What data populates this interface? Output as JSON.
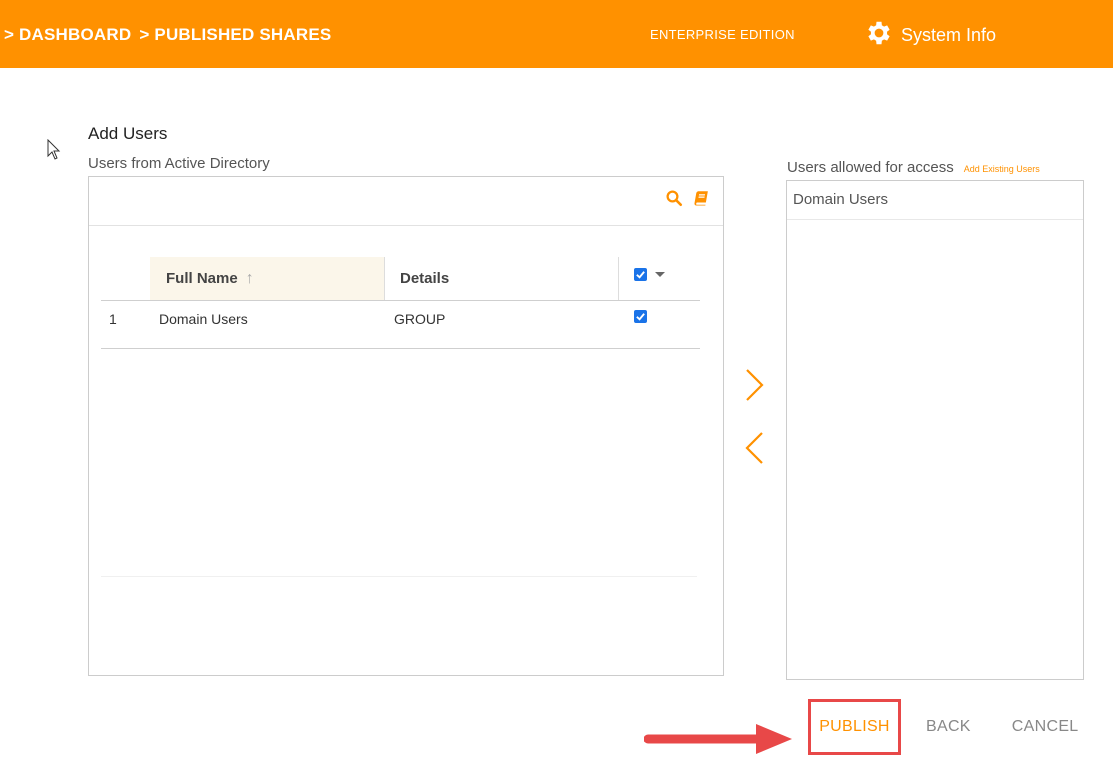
{
  "header": {
    "breadcrumbs": [
      "> DASHBOARD",
      "> PUBLISHED SHARES"
    ],
    "edition": "ENTERPRISE EDITION",
    "system_info": "System Info"
  },
  "page": {
    "title": "Add Users",
    "left_label": "Users from Active Directory",
    "right_label": "Users allowed for access",
    "add_existing": "Add Existing Users"
  },
  "grid": {
    "columns": {
      "num": "",
      "name": "Full Name",
      "details": "Details"
    },
    "header_checked": true,
    "rows": [
      {
        "num": "1",
        "name": "Domain Users",
        "details": "GROUP",
        "checked": true
      }
    ]
  },
  "allowed": {
    "items": [
      "Domain Users"
    ]
  },
  "actions": {
    "publish": "PUBLISH",
    "back": "BACK",
    "cancel": "CANCEL"
  },
  "colors": {
    "accent": "#ff9100",
    "highlight": "#e84848",
    "checkbox": "#1a73e8"
  },
  "icons": {
    "settings": "gear-icon",
    "search": "search-icon",
    "directory": "book-icon",
    "sort": "arrow-up-icon",
    "move_right": "chevron-right-icon",
    "move_left": "chevron-left-icon"
  }
}
